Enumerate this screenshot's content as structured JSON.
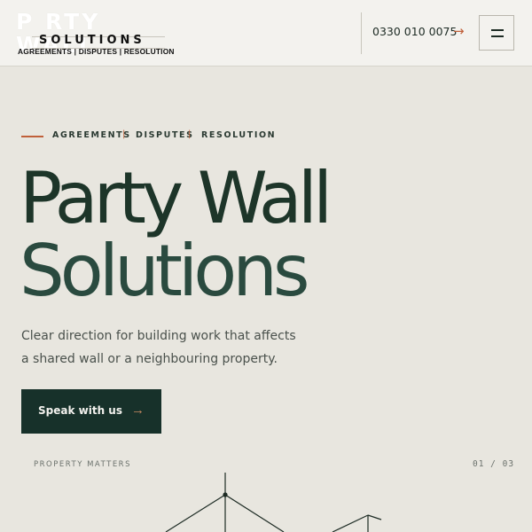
{
  "header": {
    "logo": {
      "line1": "P  RTY WALL",
      "line2": "SOLUTIONS",
      "line3": "AGREEMENTS | DISPUTES | RESOLUTION"
    },
    "phone": "0330 010 0075",
    "phone_arrow": "→",
    "menu_icon": "hamburger-icon"
  },
  "hero": {
    "eyebrow": {
      "items": [
        "AGREEMENTS",
        "DISPUTES",
        "RESOLUTION"
      ],
      "separator": "|"
    },
    "title_line1": "Party Wall",
    "title_line2": "Solutions",
    "description": "Clear direction for building work that affects a shared wall or a neighbouring property.",
    "cta": {
      "label": "Speak with us",
      "arrow": "→"
    }
  },
  "footer_strip": {
    "label": "PROPERTY MATTERS",
    "pager": "01 / 03"
  },
  "colors": {
    "background": "#e8e6df",
    "header_bg": "#f3f2ee",
    "accent": "#c0603a",
    "dark_green": "#17312a",
    "title_green": "#1d3529"
  }
}
